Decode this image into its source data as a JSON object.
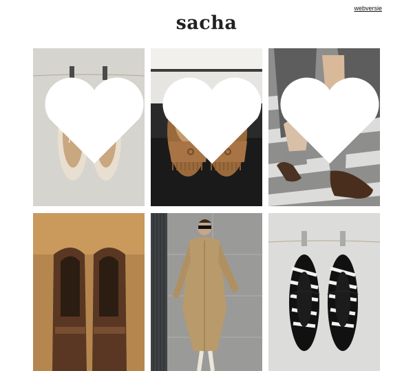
{
  "header": {
    "web_version_link": "webversie",
    "logo": "sacha"
  },
  "products": [
    {
      "image": "beige-knit-ballet-flats",
      "heart_icon": "heart-icon"
    },
    {
      "image": "brown-suede-fringe-mules",
      "heart_icon": "heart-icon"
    },
    {
      "image": "grey-socks-brown-loafers-street",
      "heart_icon": "heart-icon"
    },
    {
      "image": "brown-leather-loafers-closeup"
    },
    {
      "image": "model-in-beige-jacket"
    },
    {
      "image": "zebra-print-ballet-flats"
    }
  ]
}
